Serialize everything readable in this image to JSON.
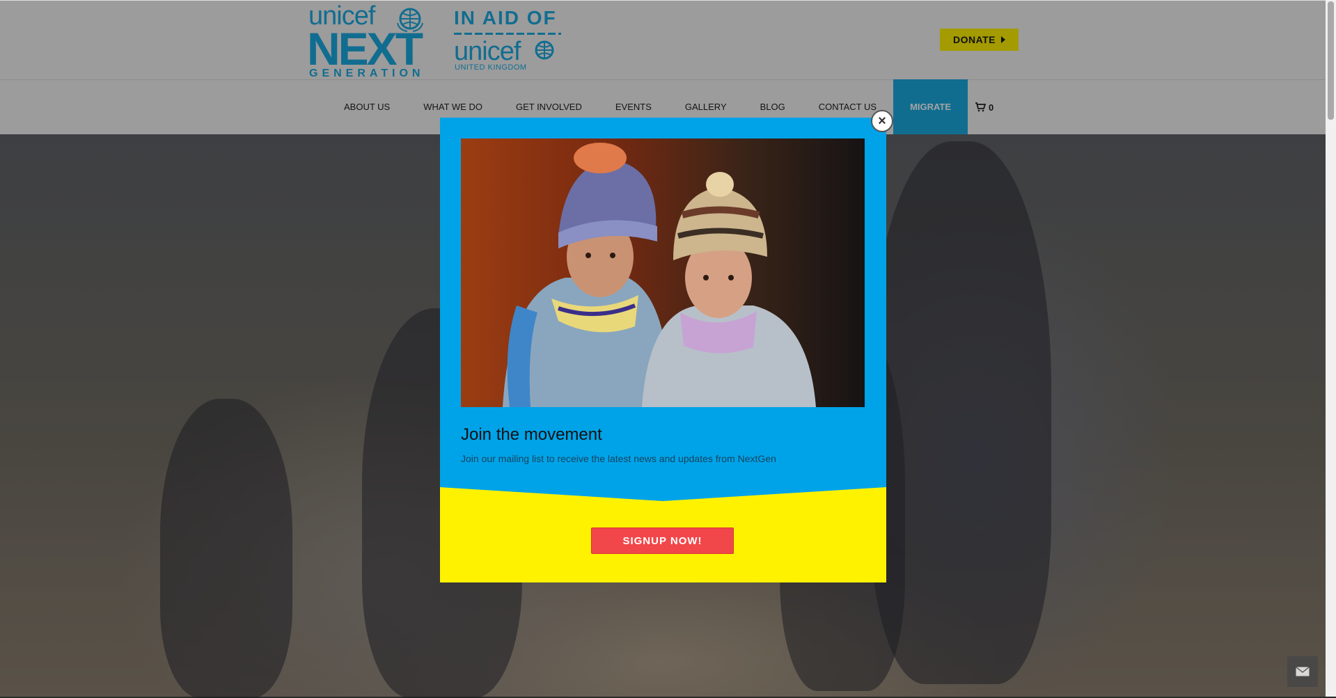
{
  "header": {
    "logo": {
      "unicef": "unicef",
      "next": "NEXT",
      "generation": "GENERATION"
    },
    "in_aid_of": {
      "title": "IN AID OF",
      "unicef": "unicef",
      "country": "UNITED KINGDOM"
    },
    "donate_label": "DONATE",
    "nav": [
      {
        "label": "ABOUT US"
      },
      {
        "label": "WHAT WE DO"
      },
      {
        "label": "GET INVOLVED"
      },
      {
        "label": "EVENTS"
      },
      {
        "label": "GALLERY"
      },
      {
        "label": "BLOG"
      },
      {
        "label": "CONTACT US"
      },
      {
        "label": "MIGRATE"
      }
    ],
    "cart_count": "0"
  },
  "modal": {
    "heading": "Join the movement",
    "subtext": "Join our mailing list to receive the latest news and updates from NextGen",
    "signup_label": "SIGNUP NOW!",
    "close_glyph": "×"
  },
  "icons": {
    "cart": "cart-icon",
    "mail": "envelope-icon",
    "close": "close-icon",
    "globe": "unicef-globe-icon"
  },
  "colors": {
    "brand_blue": "#1cabe2",
    "donate_yellow": "#fff200",
    "modal_blue": "#00a3e8",
    "signup_red": "#f1474a"
  }
}
